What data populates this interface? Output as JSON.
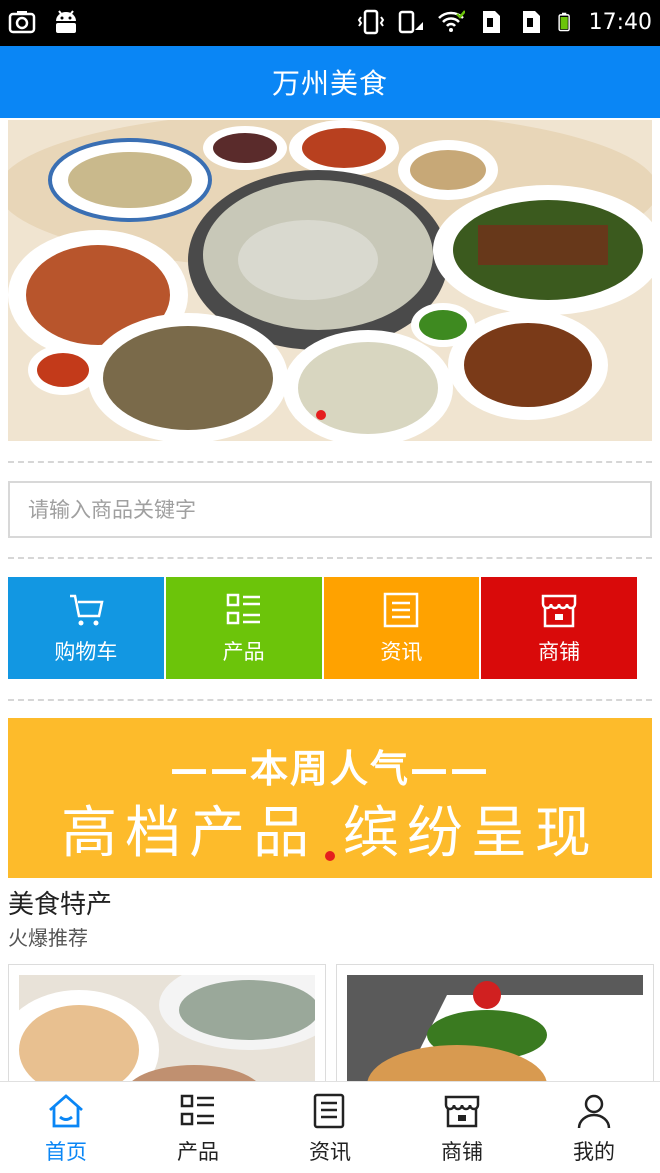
{
  "status_bar": {
    "time": "17:40",
    "icons": [
      "camera-icon",
      "android-icon",
      "vibrate-icon",
      "phone-signal-icon",
      "wifi-icon",
      "sim1-icon",
      "sim2-icon",
      "battery-icon"
    ]
  },
  "app_bar": {
    "title": "万州美食"
  },
  "banner": {
    "slides": 2,
    "active_index": 1
  },
  "search": {
    "placeholder": "请输入商品关键字"
  },
  "tiles": [
    {
      "label": "购物车",
      "icon": "cart-icon",
      "color": "#1297e2"
    },
    {
      "label": "产品",
      "icon": "list-icon",
      "color": "#6cc40a"
    },
    {
      "label": "资讯",
      "icon": "news-icon",
      "color": "#ffa200"
    },
    {
      "label": "商铺",
      "icon": "store-icon",
      "color": "#d90a0a"
    }
  ],
  "promo": {
    "line1": "——本周人气——",
    "line2": "高档产品 缤纷呈现",
    "color": "#fdbb2b"
  },
  "section": {
    "title": "美食特产",
    "subtitle": "火爆推荐"
  },
  "bottom_nav": [
    {
      "label": "首页",
      "icon": "home-icon",
      "active": true
    },
    {
      "label": "产品",
      "icon": "list-icon",
      "active": false
    },
    {
      "label": "资讯",
      "icon": "news-icon",
      "active": false
    },
    {
      "label": "商铺",
      "icon": "store-icon",
      "active": false
    },
    {
      "label": "我的",
      "icon": "user-icon",
      "active": false
    }
  ],
  "colors": {
    "accent": "#0a86f5"
  }
}
